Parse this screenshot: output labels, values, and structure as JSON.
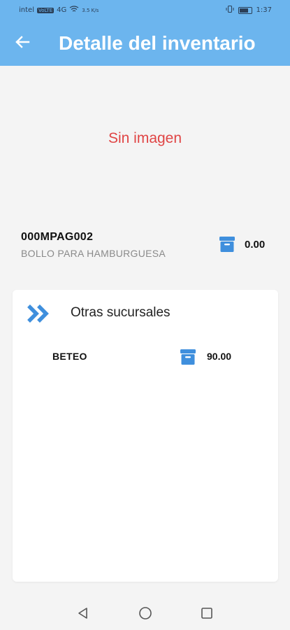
{
  "status_bar": {
    "carrier": "intel",
    "volte": "VoLTE",
    "network": "4G",
    "speed": "3.5 K/s",
    "time": "1:37"
  },
  "app_bar": {
    "title": "Detalle del inventario",
    "back_icon": "arrow-left-icon"
  },
  "image_placeholder": "Sin imagen",
  "product": {
    "code": "000MPAG002",
    "name": "BOLLO PARA HAMBURGUESA",
    "quantity": "0.00",
    "icon": "archive-box-icon"
  },
  "other_branches": {
    "title": "Otras sucursales",
    "icon": "double-chevron-right-icon",
    "items": [
      {
        "name": "BETEO",
        "quantity": "90.00",
        "icon": "archive-box-icon"
      }
    ]
  },
  "colors": {
    "app_bar": "#6cb5ee",
    "accent_icon": "#3f8fdd",
    "placeholder_text": "#e04545",
    "background": "#f4f4f4"
  }
}
